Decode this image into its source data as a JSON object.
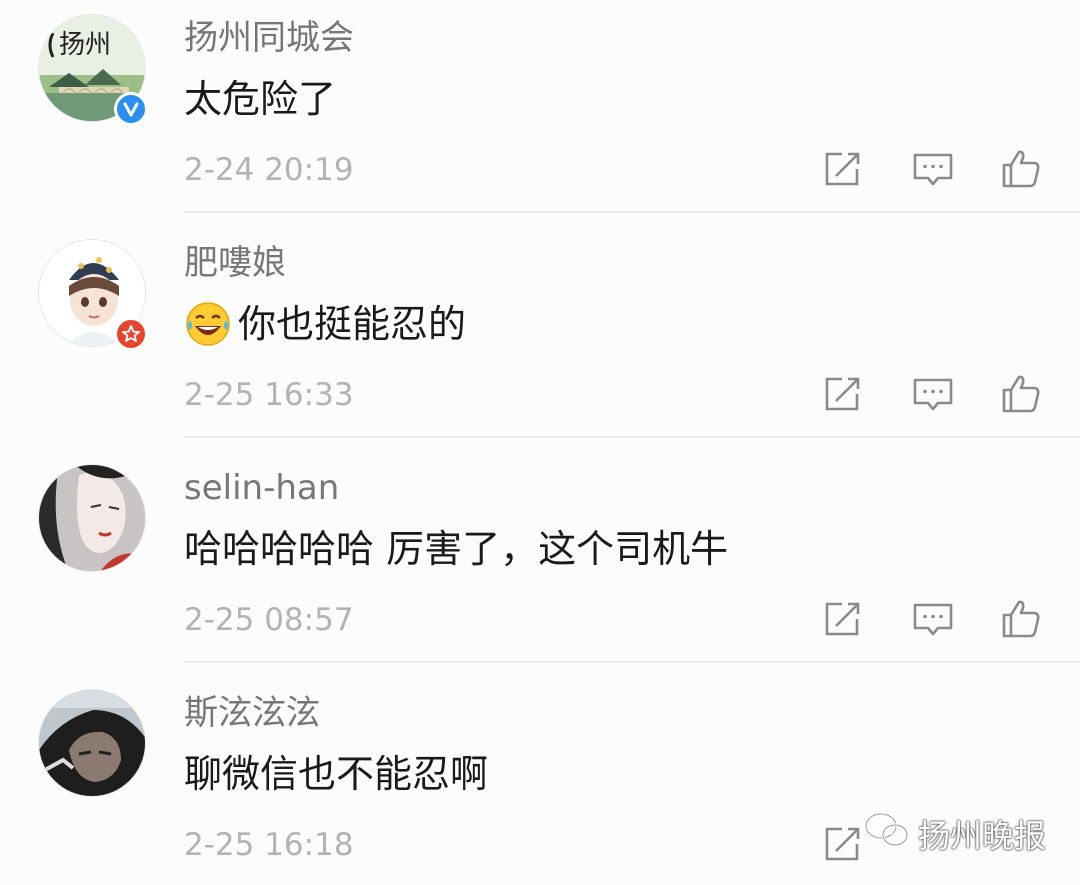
{
  "comments": [
    {
      "username": "扬州同城会",
      "text": "太危险了",
      "time": "2-24 20:19",
      "avatar": "yangzhou-city-avatar",
      "badge": "verified-blue-v-icon",
      "avatar_text": "扬州"
    },
    {
      "username": "肥嘍娘",
      "text": "你也挺能忍的",
      "emoji": "laughing-tears-emoji",
      "time": "2-25 16:33",
      "avatar": "cartoon-boy-avatar",
      "badge": "red-star-badge-icon"
    },
    {
      "username": "selin-han",
      "text": "哈哈哈哈哈 厉害了，这个司机牛",
      "time": "2-25 08:57",
      "avatar": "illustrated-woman-avatar"
    },
    {
      "username": "斯泫泫泫",
      "text": "聊微信也不能忍啊",
      "time": "2-25 16:18",
      "avatar": "hooded-person-avatar"
    }
  ],
  "actions": [
    "repost-icon",
    "comment-icon",
    "like-icon"
  ],
  "watermark": {
    "text": "扬州晚报",
    "icon": "wechat-icon"
  },
  "colors": {
    "username": "#777777",
    "text": "#1a1a1a",
    "time": "#b3b3b3",
    "icon": "#8a8a8a",
    "verified": "#2a8ff0",
    "star_badge": "#e5452f"
  }
}
